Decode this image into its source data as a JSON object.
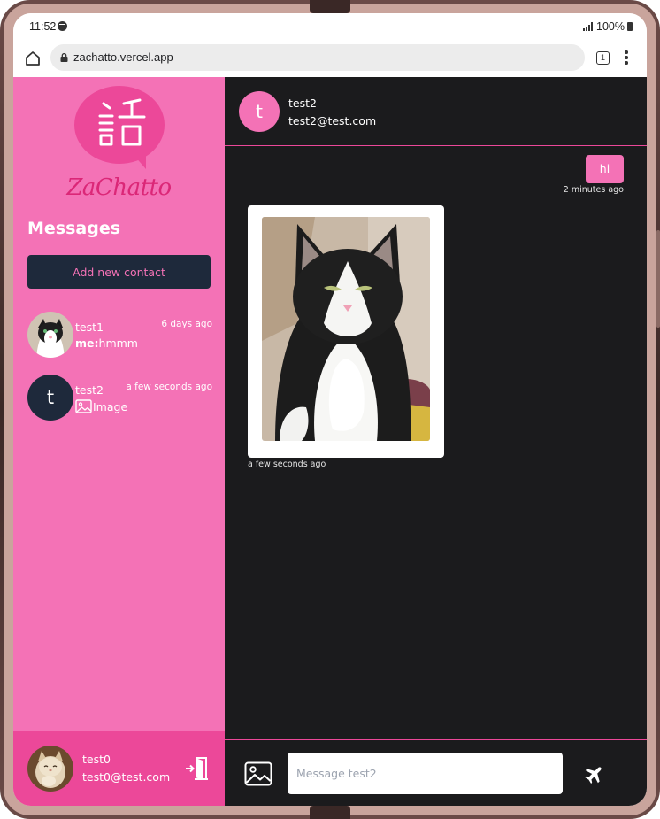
{
  "status_bar": {
    "time": "11:52",
    "battery": "100%"
  },
  "browser": {
    "url": "zachatto.vercel.app",
    "tab_count": "1"
  },
  "app": {
    "logo_text": "ZaChatto",
    "messages_title": "Messages",
    "add_contact_label": "Add new contact"
  },
  "contacts": [
    {
      "name": "test1",
      "time": "6 days ago",
      "preview_prefix": "me:",
      "preview_text": "hmmm"
    },
    {
      "name": "test2",
      "time": "a few seconds ago",
      "avatar_letter": "t",
      "preview_text": "Image"
    }
  ],
  "current_user": {
    "name": "test0",
    "email": "test0@test.com"
  },
  "chat": {
    "header": {
      "avatar_letter": "t",
      "name": "test2",
      "email": "test2@test.com"
    },
    "messages": [
      {
        "text": "hi",
        "time": "2 minutes ago",
        "direction": "outgoing"
      },
      {
        "type": "image",
        "time": "a few seconds ago",
        "direction": "incoming"
      }
    ],
    "input_placeholder": "Message test2"
  },
  "colors": {
    "pink": "#f472b6",
    "dark_pink": "#ec4899",
    "navy": "#1e293b",
    "chat_bg": "#1b1b1d"
  }
}
